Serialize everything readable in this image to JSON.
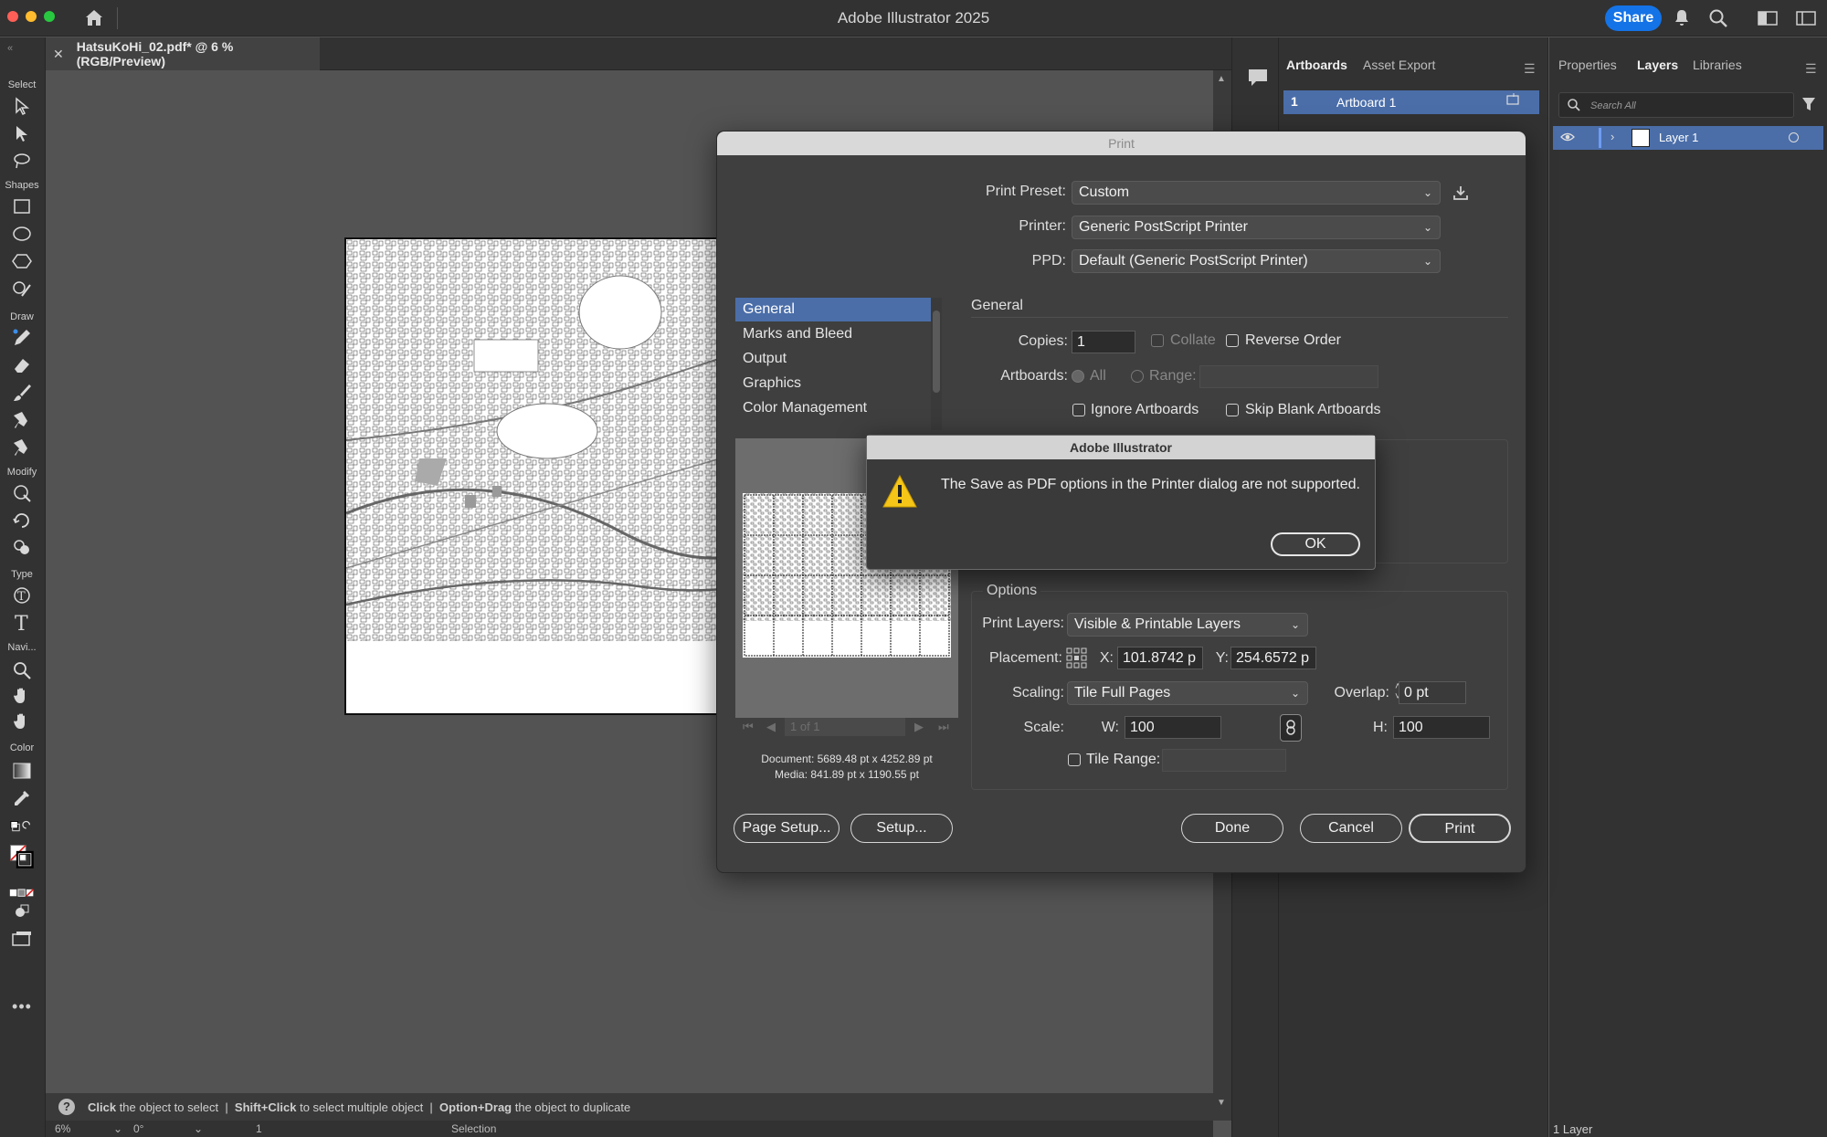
{
  "app": {
    "title": "Adobe Illustrator 2025",
    "share_label": "Share"
  },
  "document": {
    "tab_title": "HatsuKoHi_02.pdf* @ 6 % (RGB/Preview)"
  },
  "toolbar": {
    "sections": [
      "Select",
      "Shapes",
      "Draw",
      "Modify",
      "Type",
      "Navi...",
      "Color"
    ]
  },
  "status": {
    "hint_parts": [
      "Click",
      " the object to select  |  ",
      "Shift+Click",
      " to select multiple object  |  ",
      "Option+Drag",
      " the object to duplicate"
    ],
    "zoom": "6%",
    "rotation": "0°",
    "artboard_num": "1",
    "mode": "Selection"
  },
  "artboards_panel": {
    "tabs": [
      "Artboards",
      "Asset Export"
    ],
    "items": [
      {
        "num": "1",
        "name": "Artboard 1"
      }
    ]
  },
  "layers_panel": {
    "tabs": [
      "Properties",
      "Layers",
      "Libraries"
    ],
    "search_placeholder": "Search All",
    "layers": [
      {
        "name": "Layer 1"
      }
    ],
    "footer_count": "1 Layer"
  },
  "print_dialog": {
    "title": "Print",
    "preset_label": "Print Preset:",
    "preset_value": "Custom",
    "printer_label": "Printer:",
    "printer_value": "Generic PostScript Printer",
    "ppd_label": "PPD:",
    "ppd_value": "Default (Generic PostScript Printer)",
    "nav_items": [
      "General",
      "Marks and Bleed",
      "Output",
      "Graphics",
      "Color Management"
    ],
    "section_general": "General",
    "copies_label": "Copies:",
    "copies_value": "1",
    "collate_label": "Collate",
    "reverse_label": "Reverse Order",
    "artboards_label": "Artboards:",
    "all_label": "All",
    "range_label": "Range:",
    "ignore_artboards_label": "Ignore Artboards",
    "skip_blank_label": "Skip Blank Artboards",
    "options_label": "Options",
    "print_layers_label": "Print Layers:",
    "print_layers_value": "Visible & Printable Layers",
    "placement_label": "Placement:",
    "x_label": "X:",
    "x_value": "101.8742 p",
    "y_label": "Y:",
    "y_value": "254.6572 p",
    "scaling_label": "Scaling:",
    "scaling_value": "Tile Full Pages",
    "overlap_label": "Overlap:",
    "overlap_value": "0 pt",
    "scale_label": "Scale:",
    "w_label": "W:",
    "w_value": "100",
    "h_label": "H:",
    "h_value": "100",
    "tile_range_label": "Tile Range:",
    "page_nav": "1 of 1",
    "document_size": "Document:  5689.48 pt x 4252.89 pt",
    "media_size": "Media:  841.89 pt x 1190.55 pt",
    "page_setup_label": "Page Setup...",
    "setup_label": "Setup...",
    "done_label": "Done",
    "cancel_label": "Cancel",
    "print_label": "Print"
  },
  "alert": {
    "title": "Adobe Illustrator",
    "message": "The Save as PDF options in the Printer dialog are not supported.",
    "ok_label": "OK"
  },
  "colors": {
    "accent": "#1473e6",
    "selection": "#4b6ea9",
    "warning": "#f5c518"
  }
}
